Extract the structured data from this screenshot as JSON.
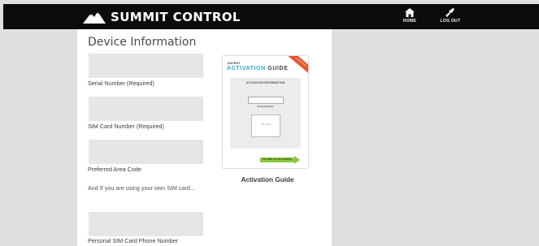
{
  "header": {
    "brand": "SUMMIT CONTROL",
    "nav": [
      {
        "label": "HOME",
        "icon": "home-icon"
      },
      {
        "label": "LOG OUT",
        "icon": "logout-icon"
      }
    ]
  },
  "section": {
    "title": "Device Information",
    "fields": [
      {
        "label": "Serial Number (Required)",
        "value": ""
      },
      {
        "label": "SIM Card Number (Required)",
        "value": ""
      },
      {
        "label": "Preferred Area Code",
        "value": ""
      },
      {
        "label": "Personal SIM Card Phone Number",
        "value": ""
      }
    ],
    "sim_note": "And If you are using your own SIM card..."
  },
  "guide": {
    "caption": "Activation Guide",
    "brand": "ASCENT",
    "title_accent": "ACTIVATION",
    "title_main": "GUIDE",
    "ribbon": "LEARN HOW",
    "inner_heading": "ACTIVATION INFORMATION",
    "serial_label": "Serial Number",
    "card_text": "SIM Card",
    "cta": "TAP HERE TO GET STARTED"
  },
  "colors": {
    "topbar": "#0b0b0b",
    "background": "#dfdfdf",
    "field": "#e6e6e6",
    "accent": "#29a7d6",
    "cta": "#8cc63f"
  }
}
